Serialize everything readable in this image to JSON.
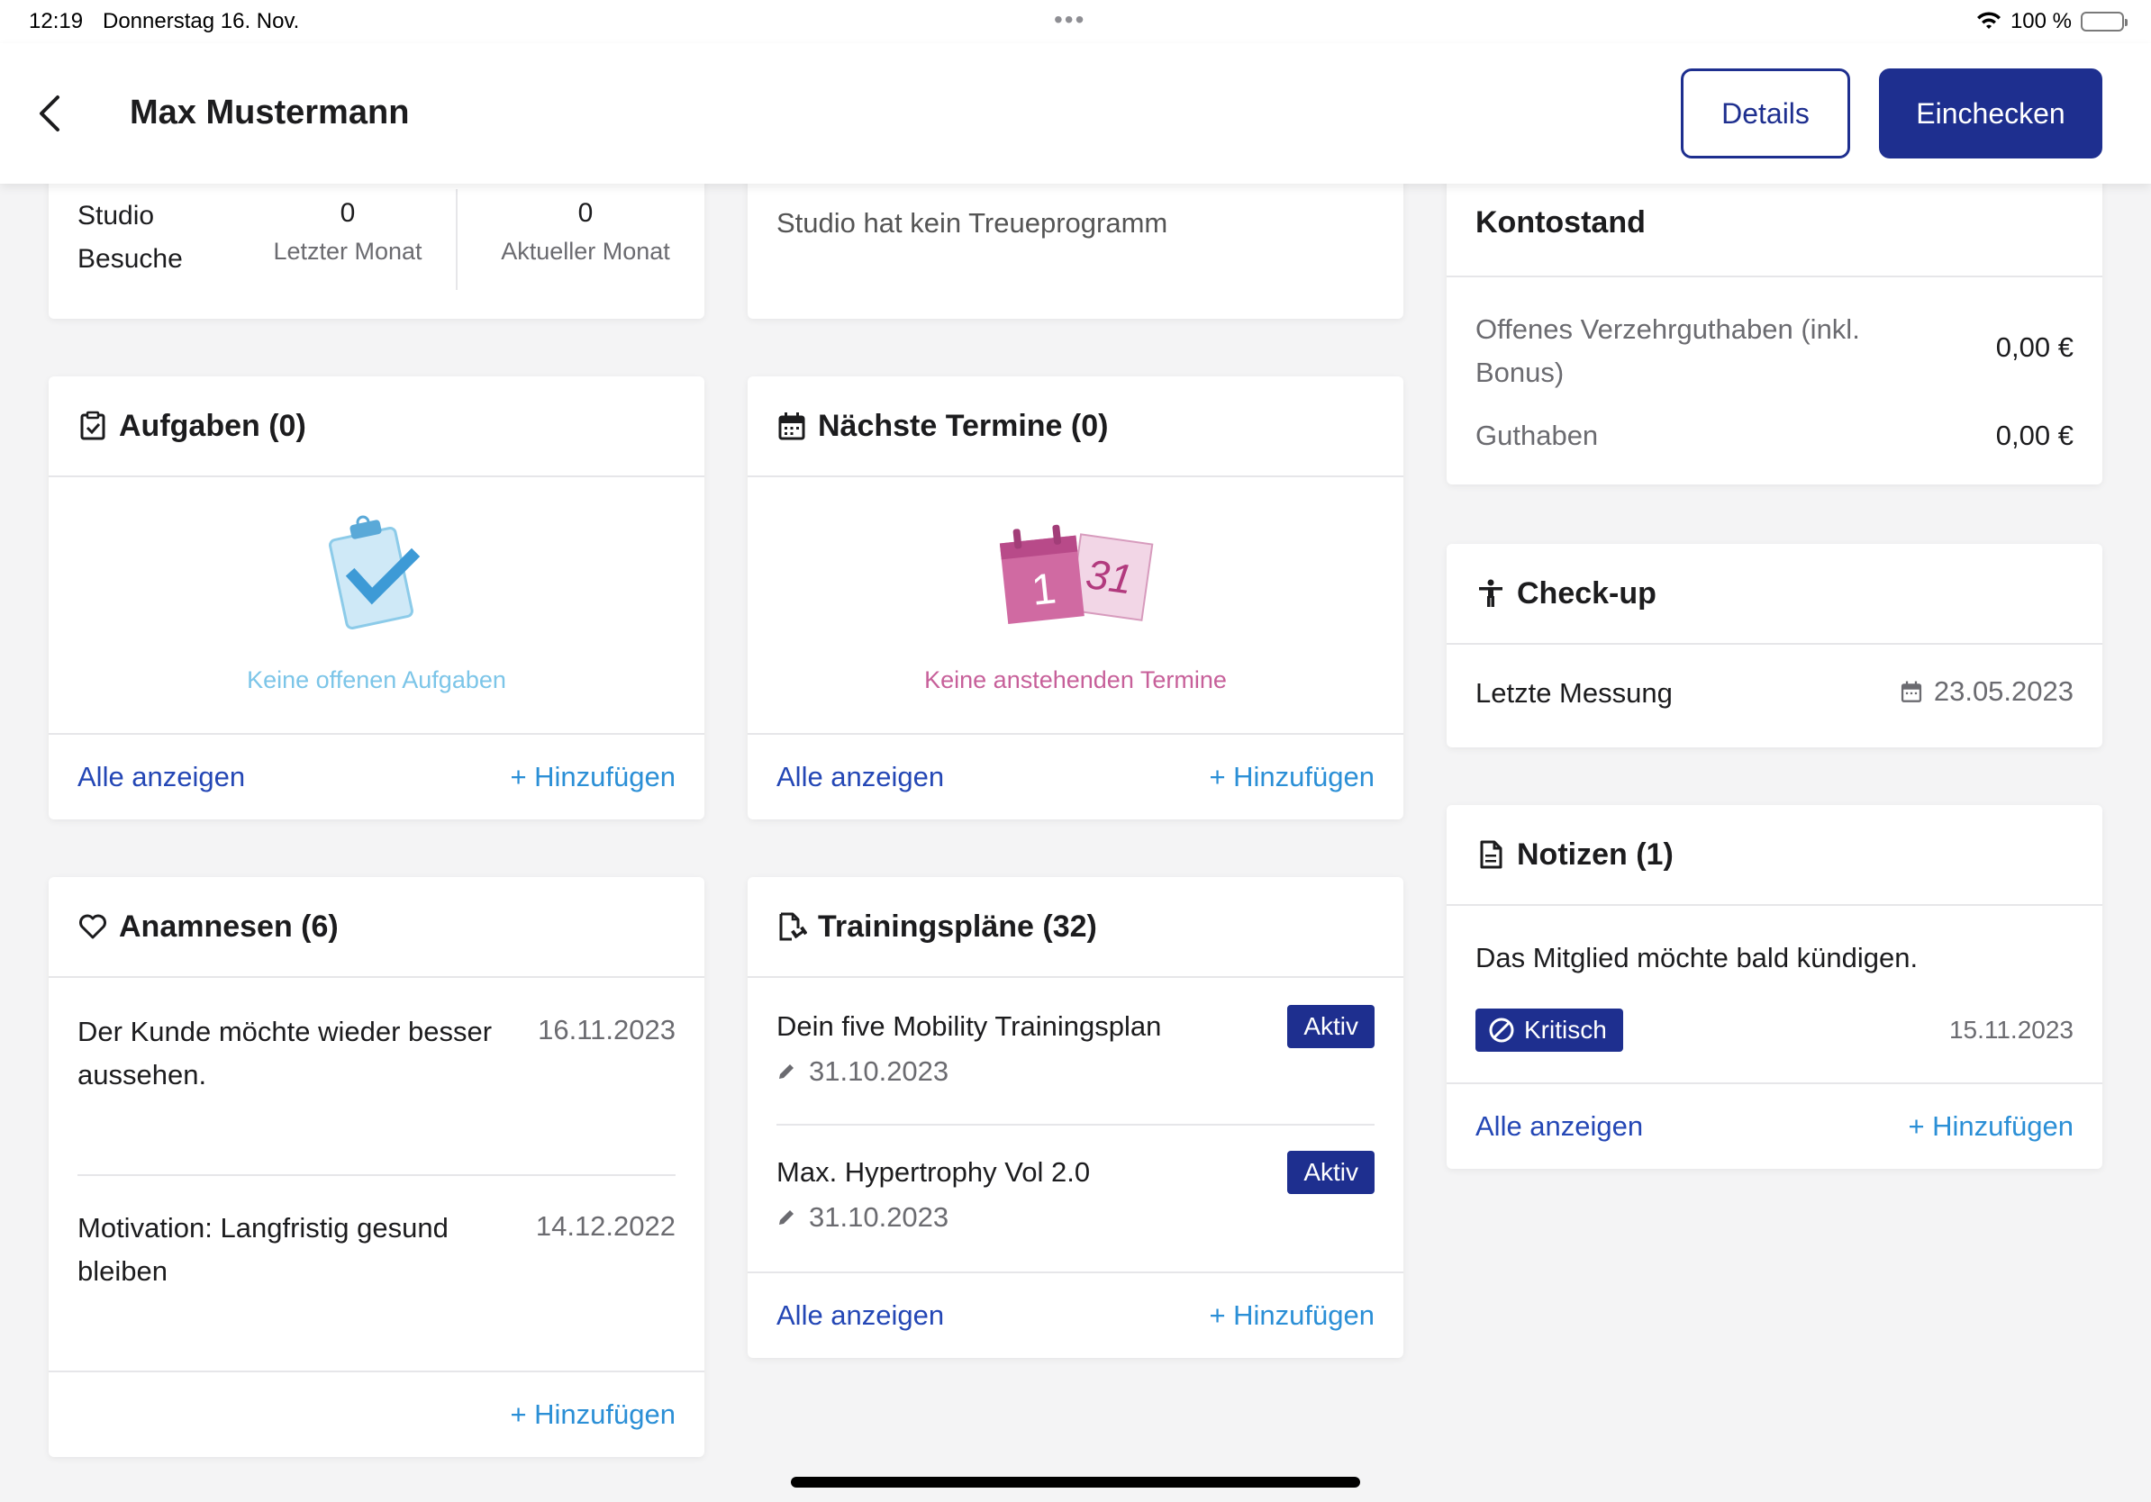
{
  "status_bar": {
    "time": "12:19",
    "date": "Donnerstag 16. Nov.",
    "battery": "100 %"
  },
  "header": {
    "title": "Max Mustermann",
    "details_label": "Details",
    "checkin_label": "Einchecken"
  },
  "visits": {
    "label_line1": "Studio",
    "label_line2": "Besuche",
    "last_month_value": "0",
    "last_month_label": "Letzter Monat",
    "current_month_value": "0",
    "current_month_label": "Aktueller Monat"
  },
  "loyalty": {
    "text": "Studio hat kein Treueprogramm"
  },
  "tasks": {
    "title": "Aufgaben (0)",
    "empty_text": "Keine offenen Aufgaben",
    "show_all": "Alle anzeigen",
    "add": "+ Hinzufügen"
  },
  "appointments": {
    "title": "Nächste Termine (0)",
    "empty_text": "Keine anstehenden Termine",
    "calendar_day_1": "1",
    "calendar_day_2": "31",
    "show_all": "Alle anzeigen",
    "add": "+ Hinzufügen"
  },
  "anamneses": {
    "title": "Anamnesen (6)",
    "items": [
      {
        "text_line1": "Der Kunde möchte wieder besser",
        "text_line2": "aussehen.",
        "date": "16.11.2023"
      },
      {
        "text_line1": "Motivation: Langfristig gesund",
        "text_line2": "bleiben",
        "date": "14.12.2022"
      }
    ],
    "add": "+ Hinzufügen"
  },
  "training_plans": {
    "title": "Trainingspläne (32)",
    "items": [
      {
        "name": "Dein five Mobility Trainingsplan",
        "date": "31.10.2023",
        "status": "Aktiv"
      },
      {
        "name": "Max. Hypertrophy Vol 2.0",
        "date": "31.10.2023",
        "status": "Aktiv"
      }
    ],
    "show_all": "Alle anzeigen",
    "add": "+ Hinzufügen"
  },
  "balance": {
    "title": "Kontostand",
    "open_credit_line1": "Offenes Verzehrguthaben (inkl.",
    "open_credit_line2": "Bonus)",
    "open_credit_value": "0,00 €",
    "credit_label": "Guthaben",
    "credit_value": "0,00 €"
  },
  "checkup": {
    "title": "Check-up",
    "last_measurement_label": "Letzte Messung",
    "last_measurement_date": "23.05.2023"
  },
  "notes": {
    "title": "Notizen (1)",
    "text": "Das Mitglied möchte bald kündigen.",
    "badge": "Kritisch",
    "date": "15.11.2023",
    "show_all": "Alle anzeigen",
    "add": "+ Hinzufügen"
  },
  "colors": {
    "primary": "#1e2f8f",
    "link": "#2447b5",
    "link_light": "#2b8fd6",
    "tasks_empty": "#7cc5e8",
    "appointments_empty": "#c7609a"
  }
}
